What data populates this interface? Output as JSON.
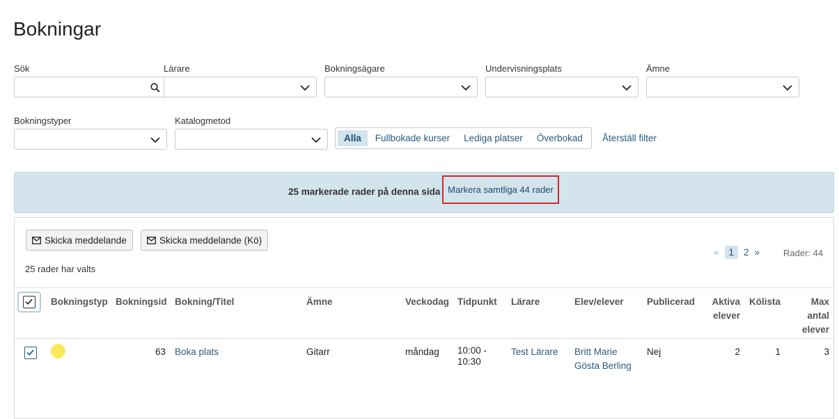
{
  "page": {
    "title": "Bokningar"
  },
  "filters": {
    "search": {
      "label": "Sök",
      "value": "",
      "placeholder": ""
    },
    "teacher": {
      "label": "Lärare",
      "value": ""
    },
    "booking_owner": {
      "label": "Bokningsägare",
      "value": ""
    },
    "teaching_location": {
      "label": "Undervisningsplats",
      "value": ""
    },
    "subject": {
      "label": "Ämne",
      "value": ""
    },
    "booking_types": {
      "label": "Bokningstyper",
      "value": ""
    },
    "catalog_method": {
      "label": "Katalogmetod",
      "value": ""
    },
    "quick_filters": [
      "Alla",
      "Fullbokade kurser",
      "Lediga platser",
      "Överbokad"
    ],
    "active_quick_filter": "Alla",
    "reset_label": "Återställ filter"
  },
  "selection_bar": {
    "text": "25 markerade rader på denna sida",
    "select_all_link": "Markera samtliga 44 rader"
  },
  "actions": {
    "send_message": "Skicka meddelande",
    "send_message_queue": "Skicka meddelande (Kö)"
  },
  "selected_count_text": "25 rader har valts",
  "pagination": {
    "prev": "«",
    "pages": [
      "1",
      "2"
    ],
    "current": "1",
    "next": "»"
  },
  "rows_info": "Rader: 44",
  "table": {
    "columns": [
      "Bokningstyp",
      "Bokningsid",
      "Bokning/Titel",
      "Ämne",
      "Veckodag",
      "Tidpunkt",
      "Lärare",
      "Elev/elever",
      "Publicerad",
      "Aktiva\nelever",
      "Kölista",
      "Max\nantal\nelever"
    ],
    "rows": [
      {
        "checked": true,
        "type_color": "#fbe85a",
        "id": "63",
        "title": "Boka plats",
        "subject": "Gitarr",
        "weekday": "måndag",
        "time": "10:00 -\n10:30",
        "teacher": "Test Lärare",
        "students": [
          "Britt Marie",
          "Gösta Berling"
        ],
        "published": "Nej",
        "active_students": "2",
        "queue": "1",
        "max_students": "3"
      }
    ]
  },
  "colors": {
    "link": "#2a5b80",
    "selection_bar_bg": "#d4e4ec",
    "highlight_border": "#d9262b",
    "active_filter_bg": "#d2e4ee"
  }
}
